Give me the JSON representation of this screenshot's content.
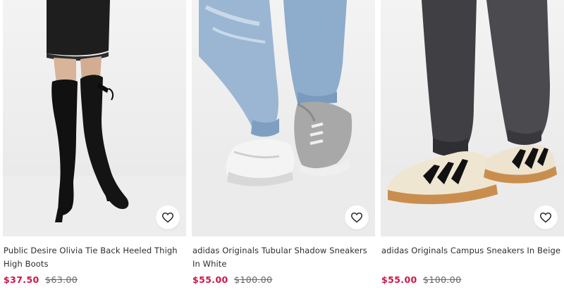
{
  "products": [
    {
      "title": "Public Desire Olivia Tie Back Heeled Thigh High Boots",
      "price": "$37.50",
      "was_price": "$63.00",
      "image": "black thigh high boots photo",
      "wishlist_icon": "heart-outline-icon"
    },
    {
      "title": "adidas Originals Tubular Shadow Sneakers In White",
      "price": "$55.00",
      "was_price": "$100.00",
      "image": "white grey sneakers with jeans photo",
      "wishlist_icon": "heart-outline-icon"
    },
    {
      "title": "adidas Originals Campus Sneakers In Beige",
      "price": "$55.00",
      "was_price": "$100.00",
      "image": "beige sneakers with black stripes photo",
      "wishlist_icon": "heart-outline-icon"
    }
  ],
  "colors": {
    "sale_price": "#d01345",
    "was_price": "#666666",
    "title_text": "#2d2d2d"
  }
}
